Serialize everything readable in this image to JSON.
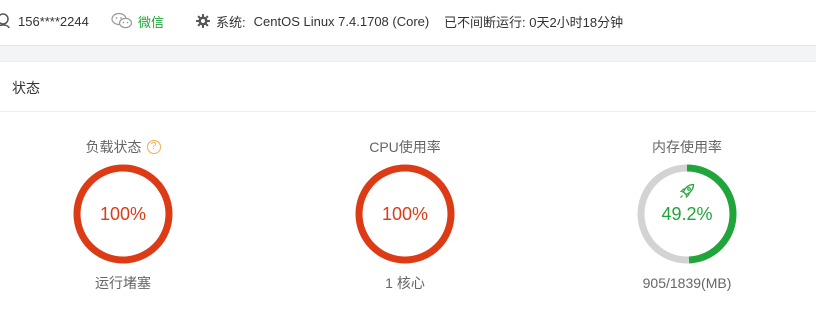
{
  "topbar": {
    "account": "156****2244",
    "wechat_label": "微信",
    "system_label": "系统:",
    "system_value": "CentOS Linux 7.4.1708 (Core)",
    "uptime": "已不间断运行: 0天2小时18分钟"
  },
  "icons": {
    "user": "user-icon",
    "wechat": "wechat-icon",
    "gear": "gear-icon",
    "help": "question-circle-icon",
    "rocket": "rocket-icon"
  },
  "status": {
    "title": "状态",
    "gauges": [
      {
        "title": "负载状态",
        "help": "?",
        "value": "100%",
        "percent": 100,
        "color": "#dd3b16",
        "sub": "运行堵塞"
      },
      {
        "title": "CPU使用率",
        "value": "100%",
        "percent": 100,
        "color": "#dd3b16",
        "sub": "1 核心"
      },
      {
        "title": "内存使用率",
        "value": "49.2%",
        "percent": 49.2,
        "color": "#20a53a",
        "sub": "905/1839(MB)"
      }
    ]
  },
  "colors": {
    "danger": "#dd3b16",
    "success": "#20a53a",
    "track": "#d3d3d3"
  }
}
